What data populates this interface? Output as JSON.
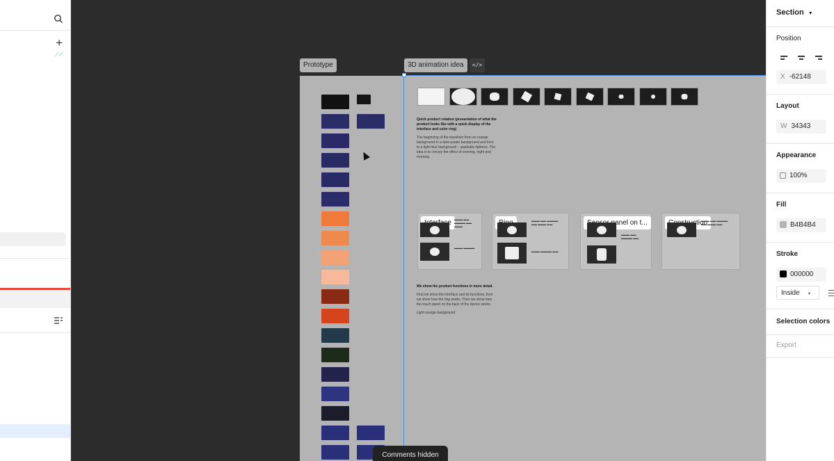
{
  "canvas": {
    "frames": [
      {
        "label": "Prototype"
      },
      {
        "label": "3D animation idea"
      }
    ],
    "code_button_label": "</>",
    "comments_pill": "Comments hidden"
  },
  "animation_frame": {
    "intro_heading": "Quick product rotation (presentation of what the product looks like with a quick display of the interface and color ring)",
    "intro_body": "The beginning of the transition from an orange background to a dark purple background and then to a light blue background – gradually lightens. The idea is to convey the effect of evening, night and morning.",
    "cards": [
      {
        "label": "Interface"
      },
      {
        "label": "Ring"
      },
      {
        "label": "Sensor panel on t..."
      },
      {
        "label": "Construction"
      }
    ],
    "detail_heading": "We show the product functions in more detail.",
    "detail_body": "First we show the interface and its functions, then we show how the ring works. Then we show how the touch panel on the back of the device works.",
    "detail_note": "Light orange background"
  },
  "right_panel": {
    "section_title": "Section",
    "position": {
      "title": "Position",
      "x_label": "X",
      "x_value": "-62148"
    },
    "layout": {
      "title": "Layout",
      "w_label": "W",
      "w_value": "34343"
    },
    "appearance": {
      "title": "Appearance",
      "opacity": "100%"
    },
    "fill": {
      "title": "Fill",
      "hex": "B4B4B4",
      "color": "#b4b4b4"
    },
    "stroke": {
      "title": "Stroke",
      "hex": "000000",
      "color": "#000000",
      "position": "Inside"
    },
    "selection_colors": "Selection colors",
    "export": "Export"
  },
  "icons": [
    "search-icon",
    "plus-icon",
    "align-list-icon",
    "code-icon",
    "chevron-down-icon",
    "align-left-icon",
    "align-center-icon",
    "align-right-icon"
  ]
}
